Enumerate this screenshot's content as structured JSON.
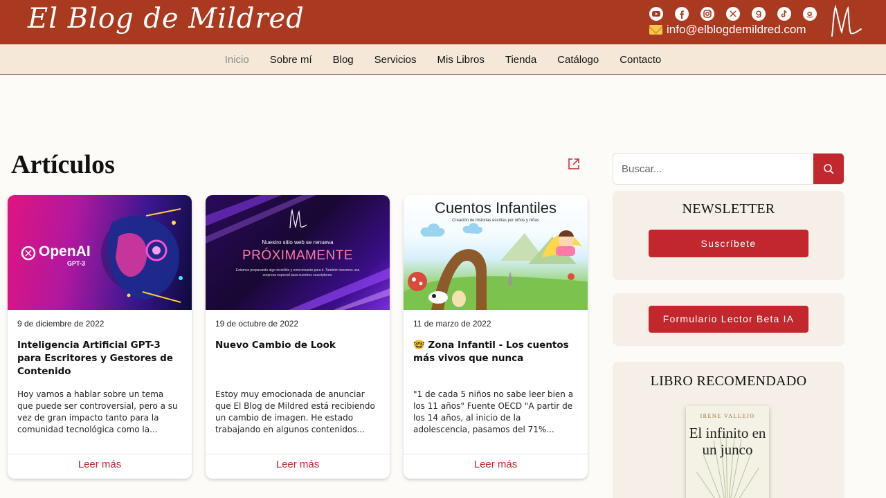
{
  "header": {
    "logo_text": "El Blog de Mildred",
    "email": "info@elblogdemildred.com",
    "social_icons": [
      "youtube-icon",
      "facebook-icon",
      "instagram-icon",
      "x-icon",
      "goodreads-icon",
      "tiktok-icon",
      "amazon-icon"
    ],
    "brand_color": "#a93a20"
  },
  "nav": {
    "items": [
      "Inicio",
      "Sobre mí",
      "Blog",
      "Servicios",
      "Mis Libros",
      "Tienda",
      "Catálogo",
      "Contacto"
    ],
    "active": "Inicio"
  },
  "main": {
    "title": "Artículos",
    "cards": [
      {
        "date": "9 de diciembre de 2022",
        "title": "Inteligencia Artificial GPT-3 para Escritores y Gestores de Contenido",
        "excerpt": "Hoy vamos a hablar sobre un tema que puede ser controversial, pero a su vez de gran impacto tanto para la comunidad tecnológica como la...",
        "image_text": "OpenAI",
        "image_subtext": "GPT-3",
        "read_more": "Leer más"
      },
      {
        "date": "19 de octubre de 2022",
        "title": "Nuevo Cambio de Look",
        "excerpt": "Estoy muy emocionada de anunciar que El Blog de Mildred está recibiendo un cambio de imagen. He estado trabajando en algunos contenidos...",
        "image_heading": "Nuestro sitio web se renueva",
        "image_text": "PRÓXIMAMENTE",
        "image_subtext": "Estamos preparando algo increíble y emocionante para ti. También tenemos una sorpresa especial para nuestros suscriptores.",
        "read_more": "Leer más"
      },
      {
        "date": "11 de marzo de 2022",
        "title": "🤓 Zona Infantil - Los cuentos más vivos que nunca",
        "excerpt": "\"1 de cada 5 niños no sabe leer bien a los 11 años\" Fuente OECD \"A partir de los 14 años, al inicio de la adolescencia, pasamos del 71%...",
        "image_text": "Cuentos Infantiles",
        "image_subtext": "Creación de historias escritas por niños y niñas",
        "read_more": "Leer más"
      }
    ]
  },
  "sidebar": {
    "search_placeholder": "Buscar...",
    "newsletter_title": "NEWSLETTER",
    "subscribe_label": "Suscríbete",
    "beta_form_label": "Formulario Lector Beta IA",
    "recommended_title": "LIBRO RECOMENDADO",
    "book_author": "IRENE VALLEJO",
    "book_title": "El infinito en un junco"
  },
  "colors": {
    "accent_red": "#c1272d",
    "nav_bg": "#f5e8d9",
    "sidebar_box_bg": "#f5efe7"
  }
}
